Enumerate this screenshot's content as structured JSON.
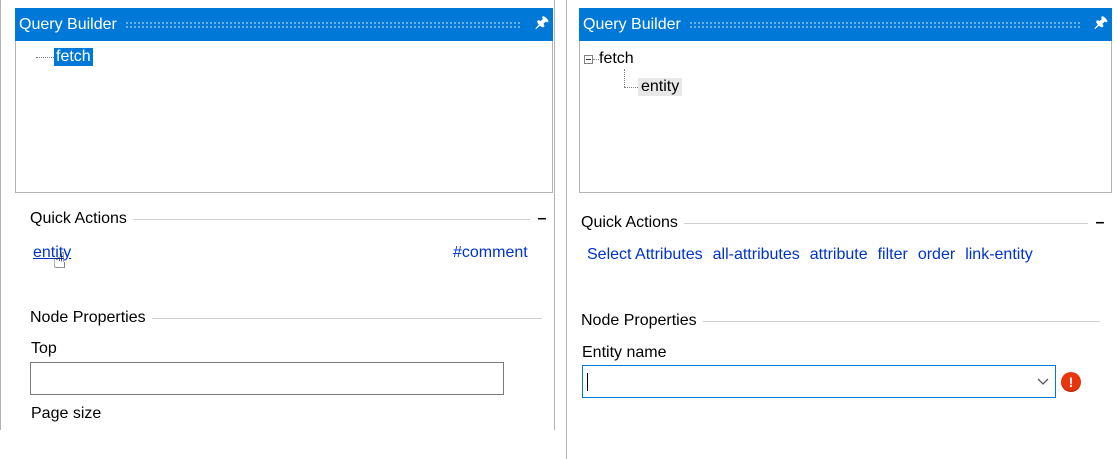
{
  "left": {
    "title": "Query Builder",
    "pin_glyph": "ᴞ",
    "tree": {
      "root": "fetch"
    },
    "quick_actions": {
      "heading": "Quick Actions",
      "collapse": "–",
      "entity_link": "entity",
      "comment_link": "#comment"
    },
    "node_properties": {
      "heading": "Node Properties",
      "top_label": "Top",
      "top_value": "",
      "page_size_label": "Page size"
    }
  },
  "right": {
    "title": "Query Builder",
    "pin_glyph": "ᴞ",
    "tree": {
      "root": "fetch",
      "child": "entity"
    },
    "quick_actions": {
      "heading": "Quick Actions",
      "collapse": "–",
      "links": [
        "Select Attributes",
        "all-attributes",
        "attribute",
        "filter",
        "order",
        "link-entity"
      ]
    },
    "node_properties": {
      "heading": "Node Properties",
      "entity_name_label": "Entity name",
      "entity_name_value": ""
    },
    "error_glyph": "!"
  },
  "colors": {
    "accent": "#0078d7",
    "link": "#0033cc",
    "error": "#e8350e"
  }
}
